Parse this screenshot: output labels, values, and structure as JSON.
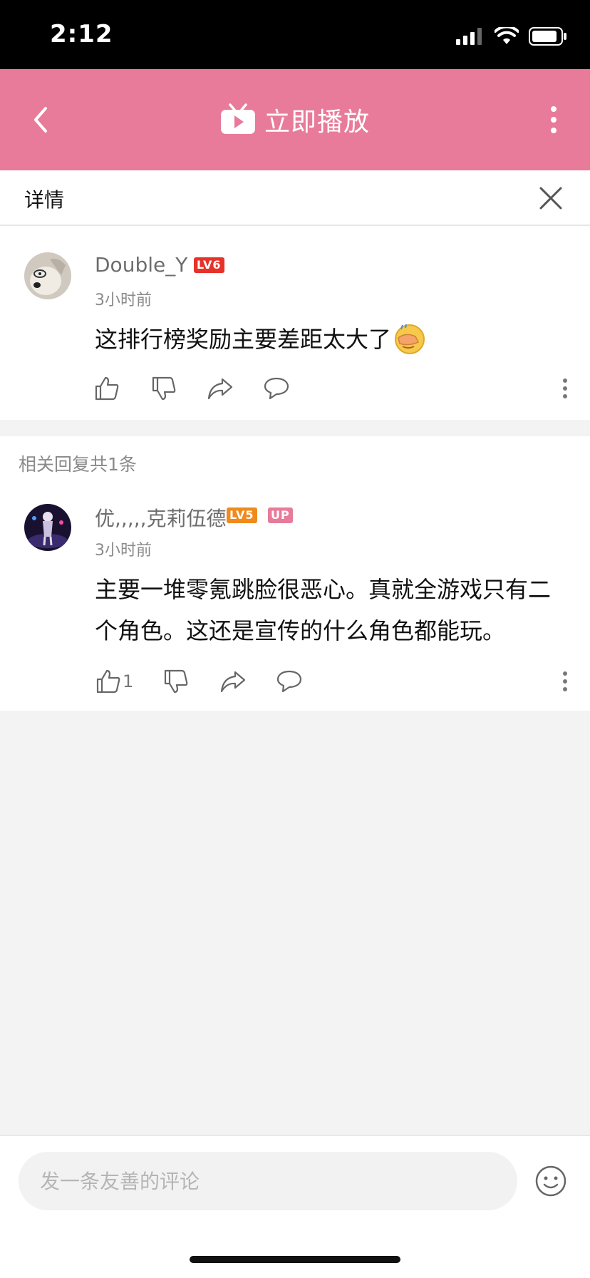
{
  "status_bar": {
    "time": "2:12"
  },
  "header": {
    "title": "立即播放",
    "accent_color": "#e87b9a"
  },
  "detail": {
    "title": "详情"
  },
  "comment": {
    "username": "Double_Y",
    "level": "LV6",
    "time": "3小时前",
    "content": "这排行榜奖励主要差距太大了",
    "emoji": "face-palm-emoji"
  },
  "replies_header": {
    "count_text": "相关回复共1条"
  },
  "reply": {
    "username": "优,,,,,克莉伍德",
    "level": "LV5",
    "up_badge": "UP",
    "time": "3小时前",
    "content": "主要一堆零氪跳脸很恶心。真就全游戏只有二个角色。这还是宣传的什么角色都能玩。",
    "like_count": "1"
  },
  "bottom": {
    "input_placeholder": "发一条友善的评论"
  }
}
